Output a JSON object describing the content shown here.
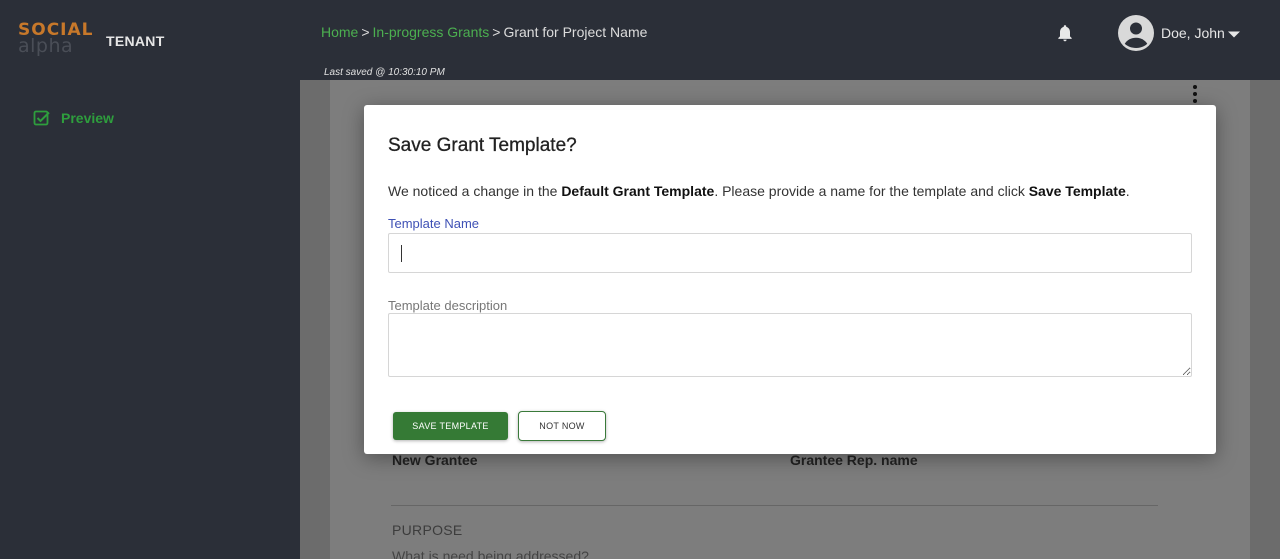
{
  "header": {
    "logo": {
      "line1": "SOCIAL",
      "line2": "alpha"
    },
    "tenant": "TENANT",
    "breadcrumb": {
      "home": "Home",
      "sep1": ">",
      "in_progress": "In-progress Grants",
      "sep2": ">",
      "current": "Grant for Project Name"
    },
    "last_saved": "Last saved @ 10:30:10 PM",
    "user_name": "Doe, John"
  },
  "sidebar": {
    "items": [
      {
        "label": "Preview"
      }
    ]
  },
  "background": {
    "field_1_label": "New Grantee",
    "field_2_label": "Grantee Rep. name",
    "section": "PURPOSE",
    "question": "What is need being addressed?"
  },
  "modal": {
    "title": "Save Grant Template?",
    "message_part1": "We noticed a change in the ",
    "message_bold1": "Default Grant Template",
    "message_part2": ". Please provide a name for the template and click ",
    "message_bold2": "Save Template",
    "message_part3": ".",
    "name_label": "Template Name",
    "name_value": "",
    "description_label": "Template description",
    "description_value": "",
    "save_button": "SAVE TEMPLATE",
    "cancel_button": "NOT NOW"
  },
  "colors": {
    "header_bg": "#2b2f38",
    "brand_orange": "#c7782a",
    "link_green": "#4caf50",
    "primary_green": "#357a35",
    "label_blue": "#3f51b5"
  },
  "icons": {
    "bell": "bell-icon",
    "avatar": "account-circle-icon",
    "caret": "caret-down-icon",
    "preview": "checkbox-edit-icon",
    "more": "more-vertical-icon"
  }
}
